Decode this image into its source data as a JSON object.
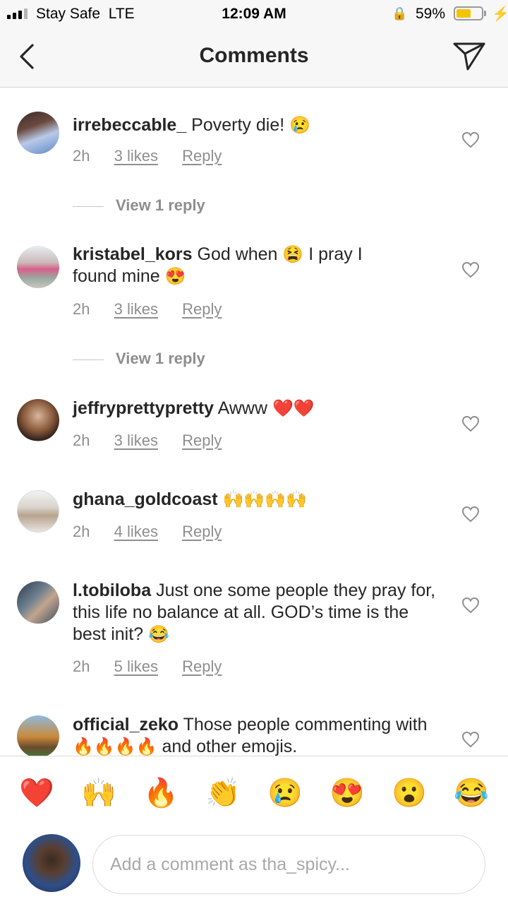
{
  "status": {
    "carrier": "Stay Safe",
    "network": "LTE",
    "time": "12:09 AM",
    "battery_pct": "59%",
    "battery_level": 0.59
  },
  "nav": {
    "title": "Comments"
  },
  "comments": [
    {
      "user": "irrebeccable_",
      "text": "Poverty die!",
      "emojis": "😢",
      "time": "2h",
      "likes": "3 likes",
      "reply": "Reply",
      "view_replies": "View 1 reply"
    },
    {
      "user": "kristabel_kors",
      "text1": "God when",
      "emoji1": "😫",
      "text2": "I pray I",
      "text3": "found mine",
      "emoji2": "😍",
      "time": "2h",
      "likes": "3 likes",
      "reply": "Reply",
      "view_replies": "View 1 reply"
    },
    {
      "user": "jeffryprettypretty",
      "text": "Awww",
      "emojis": "❤️❤️",
      "time": "2h",
      "likes": "3 likes",
      "reply": "Reply"
    },
    {
      "user": "ghana_goldcoast",
      "text": "",
      "emojis": "🙌🙌🙌🙌",
      "time": "2h",
      "likes": "4 likes",
      "reply": "Reply"
    },
    {
      "user": "l.tobiloba",
      "text": "Just one some people they pray for, this life no balance at all. GOD’s time is the best init?",
      "emojis": "😂",
      "time": "2h",
      "likes": "5 likes",
      "reply": "Reply"
    },
    {
      "user": "official_zeko",
      "text1": "Those people commenting with",
      "emojis": "🔥🔥🔥🔥",
      "text2": "and other emojis."
    }
  ],
  "quick_emojis": [
    "❤️",
    "🙌",
    "🔥",
    "👏",
    "😢",
    "😍",
    "😮",
    "😂"
  ],
  "composer": {
    "placeholder": "Add a comment as tha_spicy..."
  },
  "colors": {
    "accent_battery": "#f4c400",
    "text": "#262626",
    "secondary": "#8e8e8e"
  },
  "icons": {
    "back": "chevron-left-icon",
    "send": "paper-plane-icon",
    "like": "heart-outline-icon"
  }
}
